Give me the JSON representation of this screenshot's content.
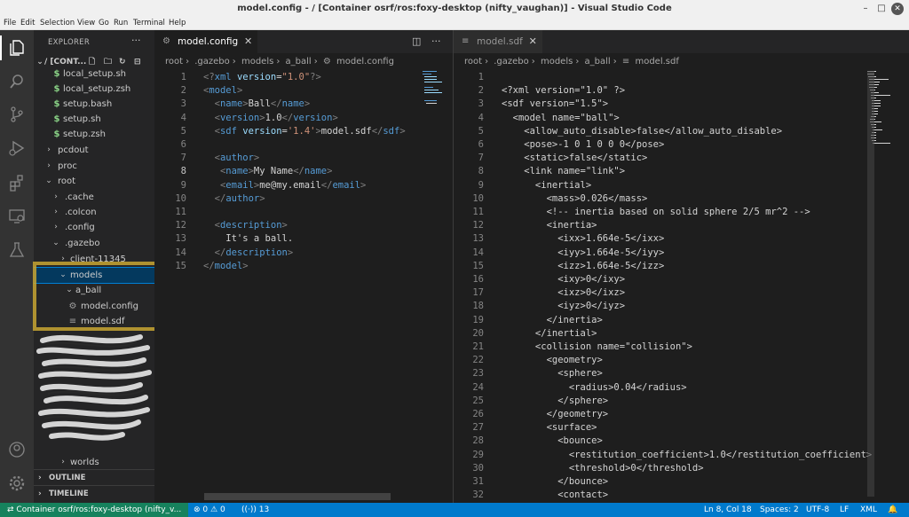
{
  "window": {
    "title": "model.config - / [Container osrf/ros:foxy-desktop (nifty_vaughan)] - Visual Studio Code"
  },
  "menu": [
    "File",
    "Edit",
    "Selection",
    "View",
    "Go",
    "Run",
    "Terminal",
    "Help"
  ],
  "sidebar": {
    "title": "EXPLORER",
    "root_label": "/ [CONT...",
    "items": [
      {
        "label": "local_setup.sh",
        "type": "file",
        "icon": "$"
      },
      {
        "label": "local_setup.zsh",
        "type": "file",
        "icon": "$"
      },
      {
        "label": "setup.bash",
        "type": "file",
        "icon": "$"
      },
      {
        "label": "setup.sh",
        "type": "file",
        "icon": "$"
      },
      {
        "label": "setup.zsh",
        "type": "file",
        "icon": "$"
      },
      {
        "label": "pcdout",
        "type": "folder-closed"
      },
      {
        "label": "proc",
        "type": "folder-closed"
      },
      {
        "label": "root",
        "type": "folder-open"
      },
      {
        "label": ".cache",
        "type": "folder-closed"
      },
      {
        "label": ".colcon",
        "type": "folder-closed"
      },
      {
        "label": ".config",
        "type": "folder-closed"
      },
      {
        "label": ".gazebo",
        "type": "folder-open"
      },
      {
        "label": "client-11345",
        "type": "folder-closed"
      },
      {
        "label": "models",
        "type": "folder-open",
        "selected": true
      },
      {
        "label": "a_ball",
        "type": "folder-open"
      },
      {
        "label": "model.config",
        "type": "file",
        "icon": "gear"
      },
      {
        "label": "model.sdf",
        "type": "file",
        "icon": "lines"
      }
    ],
    "partial_item": "worlds",
    "sections": [
      "OUTLINE",
      "TIMELINE"
    ]
  },
  "editor1": {
    "tab_label": "model.config",
    "breadcrumb": [
      "root",
      ".gazebo",
      "models",
      "a_ball",
      "model.config"
    ],
    "active_line": 8,
    "lines": [
      [
        [
          "punct",
          "<?"
        ],
        [
          "tag",
          "xml"
        ],
        [
          "attr",
          " version"
        ],
        [
          "txt",
          "="
        ],
        [
          "str",
          "\"1.0\""
        ],
        [
          "punct",
          "?>"
        ]
      ],
      [
        [
          "punct",
          "<"
        ],
        [
          "tag",
          "model"
        ],
        [
          "punct",
          ">"
        ]
      ],
      [
        [
          "txt",
          "  "
        ],
        [
          "punct",
          "<"
        ],
        [
          "tag",
          "name"
        ],
        [
          "punct",
          ">"
        ],
        [
          "txt",
          "Ball"
        ],
        [
          "punct",
          "</"
        ],
        [
          "tag",
          "name"
        ],
        [
          "punct",
          ">"
        ]
      ],
      [
        [
          "txt",
          "  "
        ],
        [
          "punct",
          "<"
        ],
        [
          "tag",
          "version"
        ],
        [
          "punct",
          ">"
        ],
        [
          "txt",
          "1.0"
        ],
        [
          "punct",
          "</"
        ],
        [
          "tag",
          "version"
        ],
        [
          "punct",
          ">"
        ]
      ],
      [
        [
          "txt",
          "  "
        ],
        [
          "punct",
          "<"
        ],
        [
          "tag",
          "sdf"
        ],
        [
          "attr",
          " version"
        ],
        [
          "txt",
          "="
        ],
        [
          "str",
          "'1.4'"
        ],
        [
          "punct",
          ">"
        ],
        [
          "txt",
          "model.sdf"
        ],
        [
          "punct",
          "</"
        ],
        [
          "tag",
          "sdf"
        ],
        [
          "punct",
          ">"
        ]
      ],
      [],
      [
        [
          "txt",
          "  "
        ],
        [
          "punct",
          "<"
        ],
        [
          "tag",
          "author"
        ],
        [
          "punct",
          ">"
        ]
      ],
      [
        [
          "txt",
          "   "
        ],
        [
          "punct",
          "<"
        ],
        [
          "tag",
          "name"
        ],
        [
          "punct",
          ">"
        ],
        [
          "txt",
          "My Name"
        ],
        [
          "punct",
          "</"
        ],
        [
          "tag",
          "name"
        ],
        [
          "punct",
          ">"
        ]
      ],
      [
        [
          "txt",
          "   "
        ],
        [
          "punct",
          "<"
        ],
        [
          "tag",
          "email"
        ],
        [
          "punct",
          ">"
        ],
        [
          "txt",
          "me@my.email"
        ],
        [
          "punct",
          "</"
        ],
        [
          "tag",
          "email"
        ],
        [
          "punct",
          ">"
        ]
      ],
      [
        [
          "txt",
          "  "
        ],
        [
          "punct",
          "</"
        ],
        [
          "tag",
          "author"
        ],
        [
          "punct",
          ">"
        ]
      ],
      [],
      [
        [
          "txt",
          "  "
        ],
        [
          "punct",
          "<"
        ],
        [
          "tag",
          "description"
        ],
        [
          "punct",
          ">"
        ]
      ],
      [
        [
          "txt",
          "    It's a ball."
        ]
      ],
      [
        [
          "txt",
          "  "
        ],
        [
          "punct",
          "</"
        ],
        [
          "tag",
          "description"
        ],
        [
          "punct",
          ">"
        ]
      ],
      [
        [
          "punct",
          "</"
        ],
        [
          "tag",
          "model"
        ],
        [
          "punct",
          ">"
        ]
      ]
    ]
  },
  "editor2": {
    "tab_label": "model.sdf",
    "breadcrumb": [
      "root",
      ".gazebo",
      "models",
      "a_ball",
      "model.sdf"
    ],
    "lines": [
      "",
      "<?xml version=\"1.0\" ?>",
      "<sdf version=\"1.5\">",
      "  <model name=\"ball\">",
      "    <allow_auto_disable>false</allow_auto_disable>",
      "    <pose>-1 0 1 0 0 0</pose>",
      "    <static>false</static>",
      "    <link name=\"link\">",
      "      <inertial>",
      "        <mass>0.026</mass>",
      "        <!-- inertia based on solid sphere 2/5 mr^2 -->",
      "        <inertia>",
      "          <ixx>1.664e-5</ixx>",
      "          <iyy>1.664e-5</iyy>",
      "          <izz>1.664e-5</izz>",
      "          <ixy>0</ixy>",
      "          <ixz>0</ixz>",
      "          <iyz>0</iyz>",
      "        </inertia>",
      "      </inertial>",
      "      <collision name=\"collision\">",
      "        <geometry>",
      "          <sphere>",
      "            <radius>0.04</radius>",
      "          </sphere>",
      "        </geometry>",
      "        <surface>",
      "          <bounce>",
      "            <restitution_coefficient>1.0</restitution_coefficient>",
      "            <threshold>0</threshold>",
      "          </bounce>",
      "          <contact>"
    ]
  },
  "statusbar": {
    "remote": "Container osrf/ros:foxy-desktop (nifty_v...",
    "errors": "0",
    "warnings": "0",
    "ports": "13",
    "position": "Ln 8, Col 18",
    "spaces": "Spaces: 2",
    "encoding": "UTF-8",
    "eol": "LF",
    "language": "XML"
  },
  "colors": {
    "accent": "#007acc",
    "remote": "#16825d",
    "highlight": "#c8a632"
  }
}
